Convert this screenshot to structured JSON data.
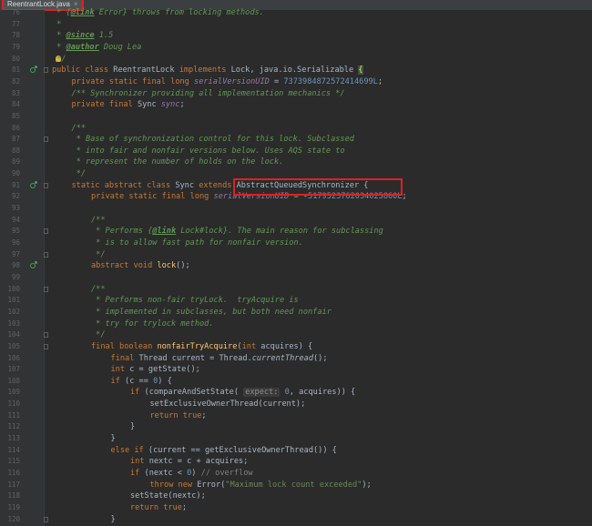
{
  "editor": {
    "tab_title": "ReentrantLock.java",
    "tab_close": "×",
    "highlight_color": "#e02020"
  },
  "lines": [
    {
      "n": "76"
    },
    {
      "n": "77"
    },
    {
      "n": "78"
    },
    {
      "n": "79"
    },
    {
      "n": "80"
    },
    {
      "n": "81"
    },
    {
      "n": "82"
    },
    {
      "n": "83"
    },
    {
      "n": "84"
    },
    {
      "n": "85"
    },
    {
      "n": "86"
    },
    {
      "n": "87"
    },
    {
      "n": "88"
    },
    {
      "n": "89"
    },
    {
      "n": "90"
    },
    {
      "n": "91"
    },
    {
      "n": "92"
    },
    {
      "n": "93"
    },
    {
      "n": "94"
    },
    {
      "n": "95"
    },
    {
      "n": "96"
    },
    {
      "n": "97"
    },
    {
      "n": "98"
    },
    {
      "n": "99"
    },
    {
      "n": "100"
    },
    {
      "n": "101"
    },
    {
      "n": "102"
    },
    {
      "n": "103"
    },
    {
      "n": "104"
    },
    {
      "n": "105"
    },
    {
      "n": "106"
    },
    {
      "n": "107"
    },
    {
      "n": "108"
    },
    {
      "n": "109"
    },
    {
      "n": "110"
    },
    {
      "n": "111"
    },
    {
      "n": "112"
    },
    {
      "n": "113"
    },
    {
      "n": "114"
    },
    {
      "n": "115"
    },
    {
      "n": "116"
    },
    {
      "n": "117"
    },
    {
      "n": "118"
    },
    {
      "n": "119"
    },
    {
      "n": "120"
    }
  ],
  "code": [
    {
      "i": 0,
      "t": [
        [
          "cm",
          " * {"
        ],
        [
          "ann",
          "@link"
        ],
        [
          "cm",
          " Error} throws from locking methods."
        ]
      ]
    },
    {
      "i": 0,
      "t": [
        [
          "cm",
          " *"
        ]
      ]
    },
    {
      "i": 0,
      "t": [
        [
          "cm",
          " * "
        ],
        [
          "ann",
          "@since"
        ],
        [
          "cm",
          " 1.5"
        ]
      ]
    },
    {
      "i": 0,
      "t": [
        [
          "cm",
          " * "
        ],
        [
          "ann",
          "@author"
        ],
        [
          "cm",
          " Doug Lea"
        ]
      ]
    },
    {
      "i": 0,
      "t": [
        [
          "cm",
          " */"
        ]
      ]
    },
    {
      "i": 0,
      "t": [
        [
          "kw",
          "public class "
        ],
        [
          "",
          "ReentrantLock "
        ],
        [
          "kw",
          "implements "
        ],
        [
          "",
          "Lock, java.io.Serializable "
        ],
        [
          "brace",
          "{"
        ]
      ]
    },
    {
      "i": 1,
      "t": [
        [
          "kw",
          "private static final long "
        ],
        [
          "fld",
          "serialVersionUID"
        ],
        [
          "",
          " = "
        ],
        [
          "num",
          "7373984872572414699L"
        ],
        [
          "",
          ";"
        ]
      ]
    },
    {
      "i": 1,
      "t": [
        [
          "cm",
          "/** Synchronizer providing all implementation mechanics */"
        ]
      ]
    },
    {
      "i": 1,
      "t": [
        [
          "kw",
          "private final "
        ],
        [
          "",
          "Sync "
        ],
        [
          "fld",
          "sync"
        ],
        [
          "",
          ";"
        ]
      ]
    },
    {
      "i": 0,
      "t": []
    },
    {
      "i": 1,
      "t": [
        [
          "cm",
          "/**"
        ]
      ]
    },
    {
      "i": 1,
      "t": [
        [
          "cm",
          " * Base of synchronization control for this lock. Subclassed"
        ]
      ]
    },
    {
      "i": 1,
      "t": [
        [
          "cm",
          " * into fair and nonfair versions below. Uses AQS state to"
        ]
      ]
    },
    {
      "i": 1,
      "t": [
        [
          "cm",
          " * represent the number of holds on the lock."
        ]
      ]
    },
    {
      "i": 1,
      "t": [
        [
          "cm",
          " */"
        ]
      ]
    },
    {
      "i": 1,
      "t": [
        [
          "kw",
          "static abstract class "
        ],
        [
          "",
          "Sync "
        ],
        [
          "kw",
          "extends "
        ],
        [
          "",
          "AbstractQueuedSynchronizer {"
        ]
      ]
    },
    {
      "i": 2,
      "t": [
        [
          "kw",
          "private static final long "
        ],
        [
          "fld",
          "serialVersionUID"
        ],
        [
          "",
          " = -"
        ],
        [
          "num",
          "5179523762034025860L"
        ],
        [
          "",
          ";"
        ]
      ]
    },
    {
      "i": 0,
      "t": []
    },
    {
      "i": 2,
      "t": [
        [
          "cm",
          "/**"
        ]
      ]
    },
    {
      "i": 2,
      "t": [
        [
          "cm",
          " * Performs {"
        ],
        [
          "ann",
          "@link"
        ],
        [
          "cm",
          " Lock#lock}. The main reason for subclassing"
        ]
      ]
    },
    {
      "i": 2,
      "t": [
        [
          "cm",
          " * is to allow fast path for nonfair version."
        ]
      ]
    },
    {
      "i": 2,
      "t": [
        [
          "cm",
          " */"
        ]
      ]
    },
    {
      "i": 2,
      "t": [
        [
          "kw",
          "abstract void "
        ],
        [
          "fn",
          "lock"
        ],
        [
          "",
          "();"
        ]
      ]
    },
    {
      "i": 0,
      "t": []
    },
    {
      "i": 2,
      "t": [
        [
          "cm",
          "/**"
        ]
      ]
    },
    {
      "i": 2,
      "t": [
        [
          "cm",
          " * Performs non-fair tryLock.  tryAcquire is"
        ]
      ]
    },
    {
      "i": 2,
      "t": [
        [
          "cm",
          " * implemented in subclasses, but both need nonfair"
        ]
      ]
    },
    {
      "i": 2,
      "t": [
        [
          "cm",
          " * try for trylock method."
        ]
      ]
    },
    {
      "i": 2,
      "t": [
        [
          "cm",
          " */"
        ]
      ]
    },
    {
      "i": 2,
      "t": [
        [
          "kw",
          "final boolean "
        ],
        [
          "fn",
          "nonfairTryAcquire"
        ],
        [
          "",
          "("
        ],
        [
          "kw",
          "int "
        ],
        [
          "",
          "acquires) {"
        ]
      ]
    },
    {
      "i": 3,
      "t": [
        [
          "kw",
          "final "
        ],
        [
          "",
          "Thread current = Thread."
        ],
        [
          "it",
          "currentThread"
        ],
        [
          "",
          "();"
        ]
      ]
    },
    {
      "i": 3,
      "t": [
        [
          "kw",
          "int "
        ],
        [
          "",
          "c = getState();"
        ]
      ]
    },
    {
      "i": 3,
      "t": [
        [
          "kw",
          "if "
        ],
        [
          "",
          "(c == "
        ],
        [
          "num",
          "0"
        ],
        [
          "",
          ") {"
        ]
      ]
    },
    {
      "i": 4,
      "t": [
        [
          "kw",
          "if "
        ],
        [
          "",
          "(compareAndSetState( "
        ],
        [
          "hint",
          "expect:"
        ],
        [
          "",
          " "
        ],
        [
          "num",
          "0"
        ],
        [
          "",
          ", acquires)) {"
        ]
      ]
    },
    {
      "i": 5,
      "t": [
        [
          "",
          "setExclusiveOwnerThread(current);"
        ]
      ]
    },
    {
      "i": 5,
      "t": [
        [
          "kw",
          "return true"
        ],
        [
          "",
          ";"
        ]
      ]
    },
    {
      "i": 4,
      "t": [
        [
          "",
          "}"
        ]
      ]
    },
    {
      "i": 3,
      "t": [
        [
          "",
          "}"
        ]
      ]
    },
    {
      "i": 3,
      "t": [
        [
          "kw",
          "else if "
        ],
        [
          "",
          "(current == getExclusiveOwnerThread()) {"
        ]
      ]
    },
    {
      "i": 4,
      "t": [
        [
          "kw",
          "int "
        ],
        [
          "",
          "nextc = c + acquires;"
        ]
      ]
    },
    {
      "i": 4,
      "t": [
        [
          "kw",
          "if "
        ],
        [
          "",
          "(nextc < "
        ],
        [
          "num",
          "0"
        ],
        [
          "",
          ") "
        ],
        [
          "ov",
          "// overflow"
        ]
      ]
    },
    {
      "i": 5,
      "t": [
        [
          "kw",
          "throw new "
        ],
        [
          "",
          "Error("
        ],
        [
          "str",
          "\"Maximum lock count exceeded\""
        ],
        [
          "",
          ");"
        ]
      ]
    },
    {
      "i": 4,
      "t": [
        [
          "",
          "setState(nextc);"
        ]
      ]
    },
    {
      "i": 4,
      "t": [
        [
          "kw",
          "return true"
        ],
        [
          "",
          ";"
        ]
      ]
    },
    {
      "i": 3,
      "t": [
        [
          "",
          "}"
        ]
      ]
    }
  ],
  "gutter_icons": {
    "81": "implements-icon",
    "91": "implements-icon",
    "98": "implements-icon"
  },
  "bulb_line": "80"
}
